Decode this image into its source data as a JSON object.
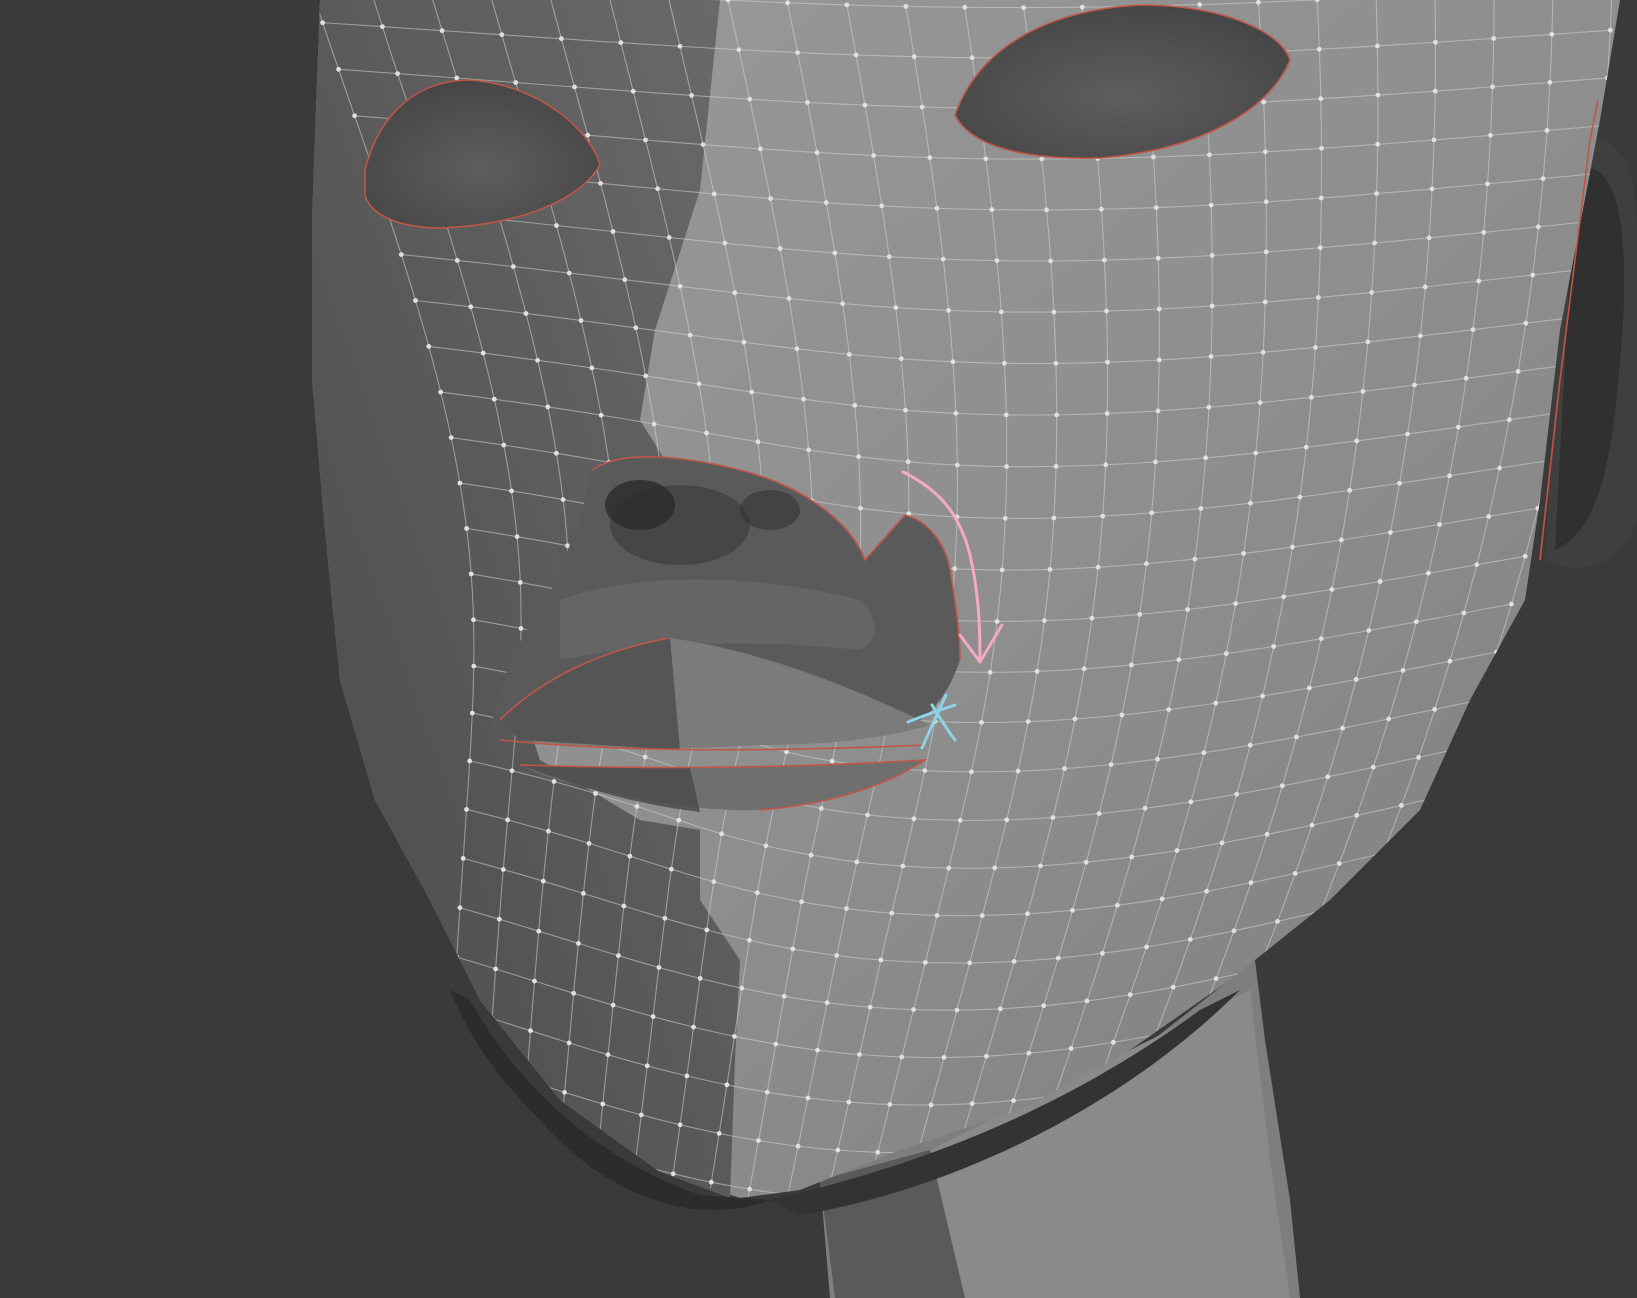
{
  "viewport": {
    "background": "#3a3a3a",
    "mesh_light": "#8f8f8f",
    "mesh_dark": "#585858",
    "wire_color": "#d4d4d4",
    "seam_color": "#c0564a",
    "arrow_color": "#f5a8c4",
    "cross_color": "#8ed2e6"
  },
  "annotations": {
    "arrow_icon": "curved-arrow-icon",
    "cross_icon": "cross-mark-icon"
  }
}
